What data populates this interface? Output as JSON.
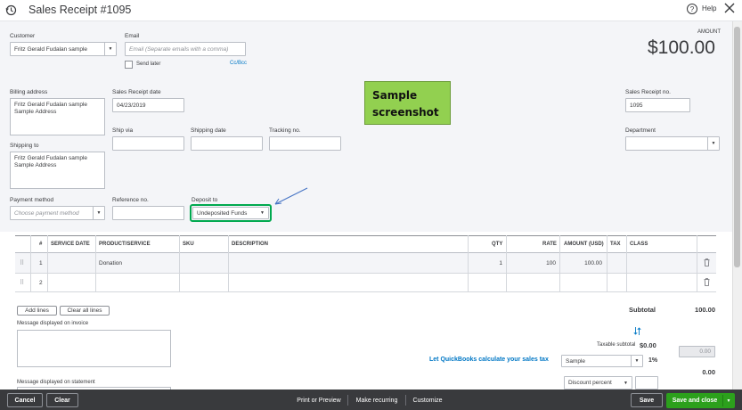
{
  "header": {
    "title": "Sales Receipt #1095",
    "help_label": "Help"
  },
  "customer": {
    "label": "Customer",
    "value": "Fritz Gerald Fudalan sample"
  },
  "email": {
    "label": "Email",
    "placeholder": "Email (Separate emails with a comma)",
    "send_later": "Send later",
    "cc_bcc": "Cc/Bcc"
  },
  "amount": {
    "label": "AMOUNT",
    "value": "$100.00"
  },
  "billing_address": {
    "label": "Billing address",
    "value": "Fritz Gerald Fudalan sample\nSample Address"
  },
  "receipt_date": {
    "label": "Sales Receipt date",
    "value": "04/23/2019"
  },
  "receipt_no": {
    "label": "Sales Receipt no.",
    "value": "1095"
  },
  "callout": {
    "line1": "Sample",
    "line2": "screenshot"
  },
  "ship_via": {
    "label": "Ship via",
    "value": ""
  },
  "shipping_date": {
    "label": "Shipping date",
    "value": ""
  },
  "tracking_no": {
    "label": "Tracking no.",
    "value": ""
  },
  "department": {
    "label": "Department",
    "value": ""
  },
  "shipping_to": {
    "label": "Shipping to",
    "value": "Fritz Gerald Fudalan sample\nSample Address"
  },
  "payment_method": {
    "label": "Payment method",
    "placeholder": "Choose payment method"
  },
  "reference_no": {
    "label": "Reference no.",
    "value": ""
  },
  "deposit_to": {
    "label": "Deposit to",
    "value": "Undeposited Funds"
  },
  "table": {
    "headers": {
      "num": "#",
      "service_date": "SERVICE DATE",
      "product": "PRODUCT/SERVICE",
      "sku": "SKU",
      "description": "DESCRIPTION",
      "qty": "QTY",
      "rate": "RATE",
      "amount": "AMOUNT (USD)",
      "tax": "TAX",
      "class": "CLASS"
    },
    "rows": [
      {
        "num": "1",
        "product": "Donation",
        "qty": "1",
        "rate": "100",
        "amount": "100.00"
      },
      {
        "num": "2",
        "product": "",
        "qty": "",
        "rate": "",
        "amount": ""
      }
    ]
  },
  "buttons": {
    "add_lines": "Add lines",
    "clear_all_lines": "Clear all lines"
  },
  "message_invoice": {
    "label": "Message displayed on invoice"
  },
  "message_statement": {
    "label": "Message displayed on statement"
  },
  "totals": {
    "subtotal_label": "Subtotal",
    "subtotal_value": "100.00",
    "taxable_label": "Taxable subtotal",
    "taxable_value": "$0.00",
    "calc_tax_link": "Let QuickBooks calculate your sales tax",
    "tax_rate_value": "Sample",
    "tax_percent": "1%",
    "tax_amount": "0.00",
    "tax_total": "0.00",
    "discount_value": "Discount percent"
  },
  "footer": {
    "cancel": "Cancel",
    "clear": "Clear",
    "print_preview": "Print or Preview",
    "make_recurring": "Make recurring",
    "customize": "Customize",
    "save": "Save",
    "save_close": "Save and close"
  },
  "colors": {
    "primary_green": "#2ca01c",
    "link_blue": "#0077c5",
    "callout_green": "#92d050",
    "footer_bg": "#393a3d",
    "highlight_border": "#00a94f"
  }
}
